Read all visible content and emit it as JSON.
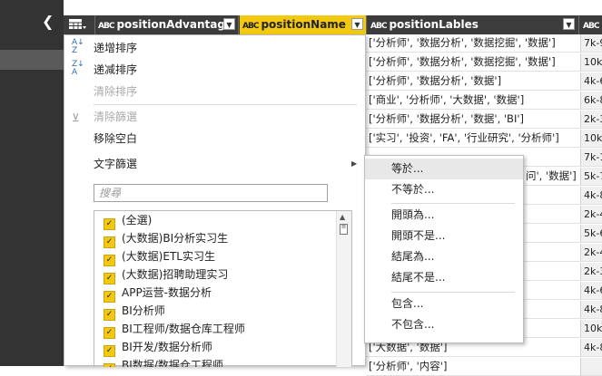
{
  "left_pane": {
    "collapse_icon": "chevron-left-icon"
  },
  "header": {
    "table_icon": "table-icon",
    "col_advantage": {
      "type": "ABC",
      "name": "positionAdvantage"
    },
    "col_name": {
      "type": "ABC",
      "name": "positionName"
    },
    "col_labels": {
      "type": "ABC",
      "name": "positionLables"
    },
    "col_next": {
      "type": "ABC"
    }
  },
  "rows": [
    {
      "labels": "['分析师', '数据分析', '数据挖掘', '数据']",
      "next": "7k-9"
    },
    {
      "labels": "['分析师', '数据分析', '数据挖掘', '数据']",
      "next": "10k-"
    },
    {
      "labels": "['分析师', '数据分析', '数据']",
      "next": "4k-6"
    },
    {
      "labels": "['商业', '分析师', '大数据', '数据']",
      "next": "6k-8"
    },
    {
      "labels": "['分析师', '数据分析', '数据', 'BI']",
      "next": "2k-3"
    },
    {
      "labels": "['实习', '投资', 'FA', '行业研究', '分析师']",
      "next": "10k-"
    },
    {
      "labels": "",
      "next": "7k-1"
    },
    {
      "labels": "问', '数据']",
      "next": "5k-7"
    },
    {
      "labels": "",
      "next": "4k-8"
    },
    {
      "labels": "",
      "next": "2k-4"
    },
    {
      "labels": "",
      "next": "5k-6"
    },
    {
      "labels": "",
      "next": "2k-4"
    },
    {
      "labels": "",
      "next": "2k-3"
    },
    {
      "labels": "",
      "next": "4k-6"
    },
    {
      "labels": "",
      "next": "4k-8"
    },
    {
      "labels": "",
      "next": "10k-"
    },
    {
      "labels": "",
      "next": "10k-"
    },
    {
      "labels": "['大数据', '数据']",
      "next": "4k-8"
    },
    {
      "labels": "['分析师', '内容']",
      "next": ""
    }
  ],
  "menu": {
    "sort_asc": "递增排序",
    "sort_desc": "递减排序",
    "clear_sort": "清除排序",
    "clear_filter": "清除篩選",
    "remove_empty": "移除空白",
    "text_filter": "文字篩選",
    "search_placeholder": "搜尋",
    "filter_items": [
      "(全選)",
      "(大数据)BI分析实习生",
      "(大数据)ETL实习生",
      "(大数据)招聘助理实习",
      "APP运营-数据分析",
      "BI分析师",
      "BI工程师/数据仓库工程师",
      "BI开发/数据分析师",
      "BI数据/数据仓工程师"
    ]
  },
  "submenu": {
    "equals": "等於...",
    "not_equals": "不等於...",
    "begins_with": "開頭為...",
    "not_begins_with": "開頭不是...",
    "ends_with": "結尾為...",
    "not_ends_with": "結尾不是...",
    "contains": "包含...",
    "not_contains": "不包含..."
  },
  "colors": {
    "accent": "#f2c811",
    "header_bg": "#3c3c3c",
    "pane_bg": "#333333"
  }
}
